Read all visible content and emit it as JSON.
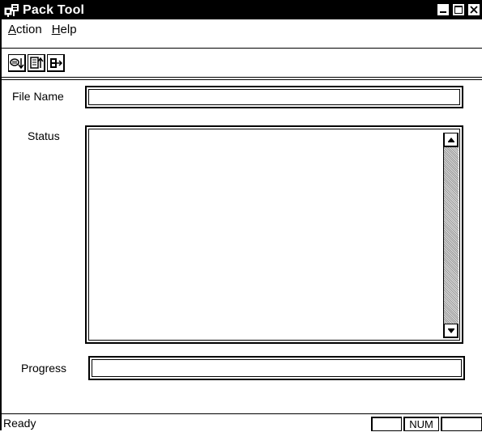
{
  "window": {
    "title": "Pack Tool"
  },
  "menu": {
    "items": [
      {
        "label": "Action"
      },
      {
        "label": "Help"
      }
    ]
  },
  "toolbar": {
    "buttons": [
      {
        "icon": "pack-icon"
      },
      {
        "icon": "unpack-icon"
      },
      {
        "icon": "exit-icon"
      }
    ]
  },
  "form": {
    "file_name_label": "File Name",
    "file_name_value": "",
    "status_label": "Status",
    "status_value": "",
    "progress_label": "Progress",
    "progress_value": ""
  },
  "statusbar": {
    "text": "Ready",
    "num_indicator": "NUM"
  },
  "colors": {
    "titlebar": "#000000",
    "background": "#ffffff",
    "scrollbar_track": "#bbbbbb"
  }
}
